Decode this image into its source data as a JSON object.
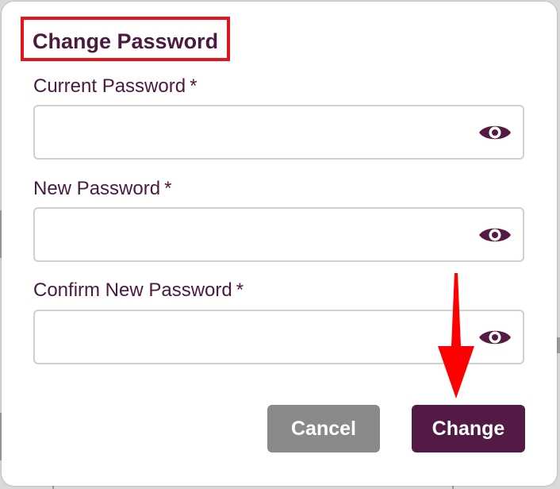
{
  "dialog": {
    "title": "Change Password",
    "fields": [
      {
        "label": "Current Password",
        "required_mark": "*",
        "value": "",
        "toggle_icon": "eye-icon"
      },
      {
        "label": "New Password",
        "required_mark": "*",
        "value": "",
        "toggle_icon": "eye-icon"
      },
      {
        "label": "Confirm New Password",
        "required_mark": "*",
        "value": "",
        "toggle_icon": "eye-icon"
      }
    ],
    "buttons": {
      "cancel_label": "Cancel",
      "change_label": "Change"
    }
  },
  "colors": {
    "brand": "#521a45",
    "text": "#4a1a3f",
    "cancel": "#8a8a8a",
    "highlight": "#e3141b",
    "arrow": "#ff0000"
  }
}
